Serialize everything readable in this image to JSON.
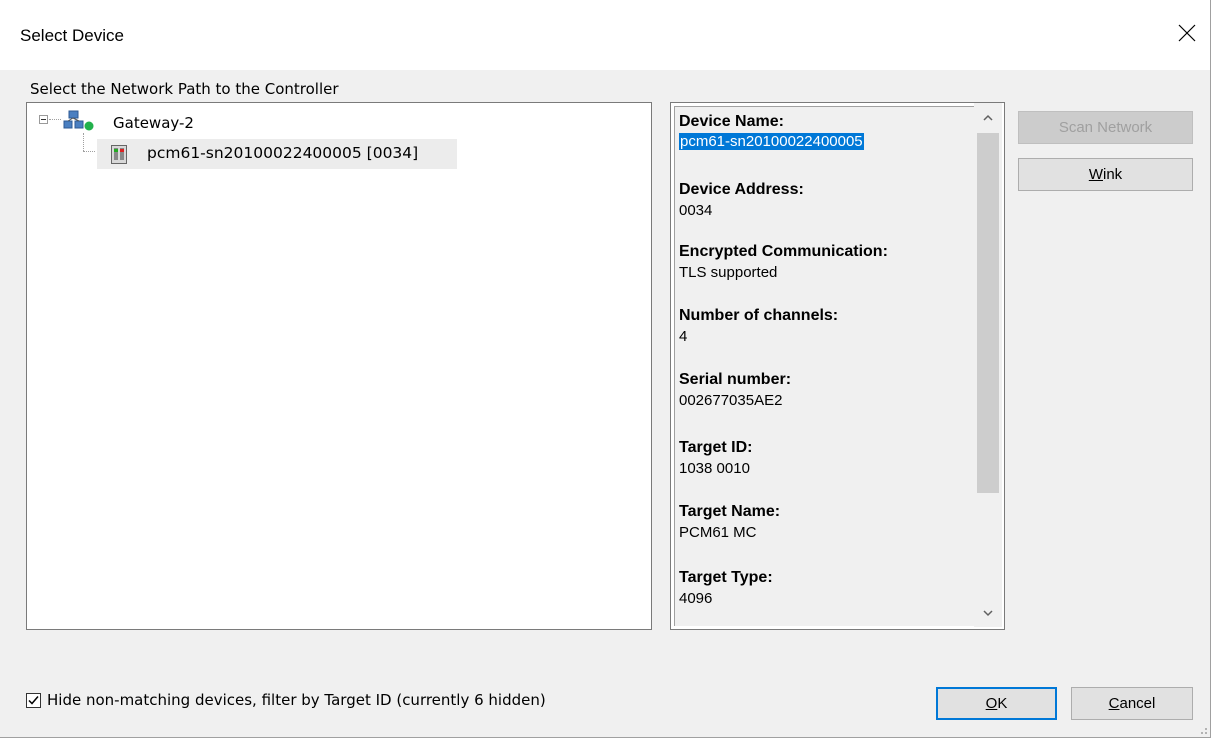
{
  "window": {
    "title": "Select Device"
  },
  "tree": {
    "label": "Select the Network Path to the Controller",
    "gateway": {
      "label": "Gateway-2",
      "icon": "network-gateway-icon",
      "status_color": "#22b14c"
    },
    "device": {
      "label": "pcm61-sn20100022400005 [0034]",
      "icon": "controller-device-icon"
    }
  },
  "properties": [
    {
      "heading": "Device Name:",
      "value": "pcm61-sn20100022400005",
      "selected": true
    },
    {
      "heading": "Device Address:",
      "value": "0034"
    },
    {
      "heading": "Encrypted Communication:",
      "value": "TLS supported"
    },
    {
      "heading": "Number of channels:",
      "value": "4"
    },
    {
      "heading": "Serial number:",
      "value": "002677035AE2"
    },
    {
      "heading": "Target ID:",
      "value": "1038 0010"
    },
    {
      "heading": "Target Name:",
      "value": "PCM61 MC"
    },
    {
      "heading": "Target Type:",
      "value": "4096"
    }
  ],
  "buttons": {
    "scan_network": "Scan Network",
    "wink_accel": "W",
    "wink_rest": "ink",
    "ok_accel": "O",
    "ok_rest": "K",
    "cancel_accel": "C",
    "cancel_rest": "ancel"
  },
  "filter": {
    "checked": true,
    "label": "Hide non-matching devices, filter by Target ID (currently 6 hidden)"
  },
  "colors": {
    "selection": "#0078d7",
    "default_button_border": "#0078d7"
  }
}
